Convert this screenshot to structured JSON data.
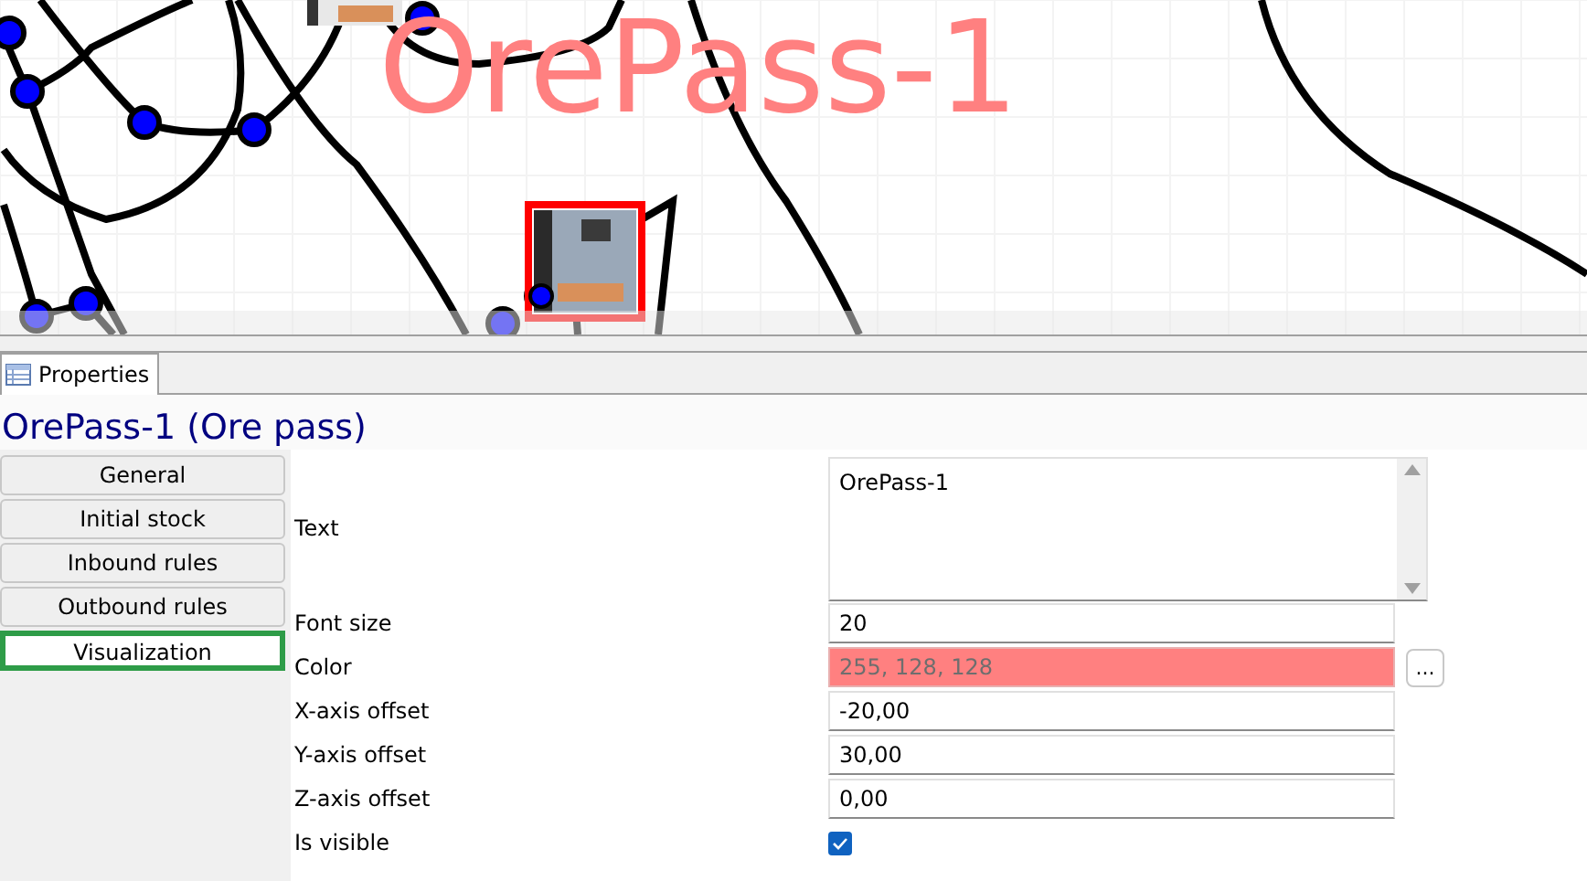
{
  "canvas": {
    "label": "OrePass-1"
  },
  "panel_tab": {
    "label": "Properties",
    "selected": true
  },
  "title": "OrePass-1 (Ore pass)",
  "sections": [
    {
      "label": "General",
      "selected": false
    },
    {
      "label": "Initial stock",
      "selected": false
    },
    {
      "label": "Inbound rules",
      "selected": false
    },
    {
      "label": "Outbound rules",
      "selected": false
    },
    {
      "label": "Visualization",
      "selected": true
    }
  ],
  "properties": [
    {
      "kind": "textarea",
      "label": "Text",
      "value": "OrePass-1"
    },
    {
      "kind": "text",
      "label": "Font size",
      "value": "20"
    },
    {
      "kind": "color",
      "label": "Color",
      "value": "255, 128, 128",
      "color": "#ff8080",
      "button": "..."
    },
    {
      "kind": "text",
      "label": "X-axis offset",
      "value": "-20,00"
    },
    {
      "kind": "text",
      "label": "Y-axis offset",
      "value": "30,00"
    },
    {
      "kind": "text",
      "label": "Z-axis offset",
      "value": "0,00"
    },
    {
      "kind": "checkbox",
      "label": "Is visible",
      "checked": true
    }
  ]
}
